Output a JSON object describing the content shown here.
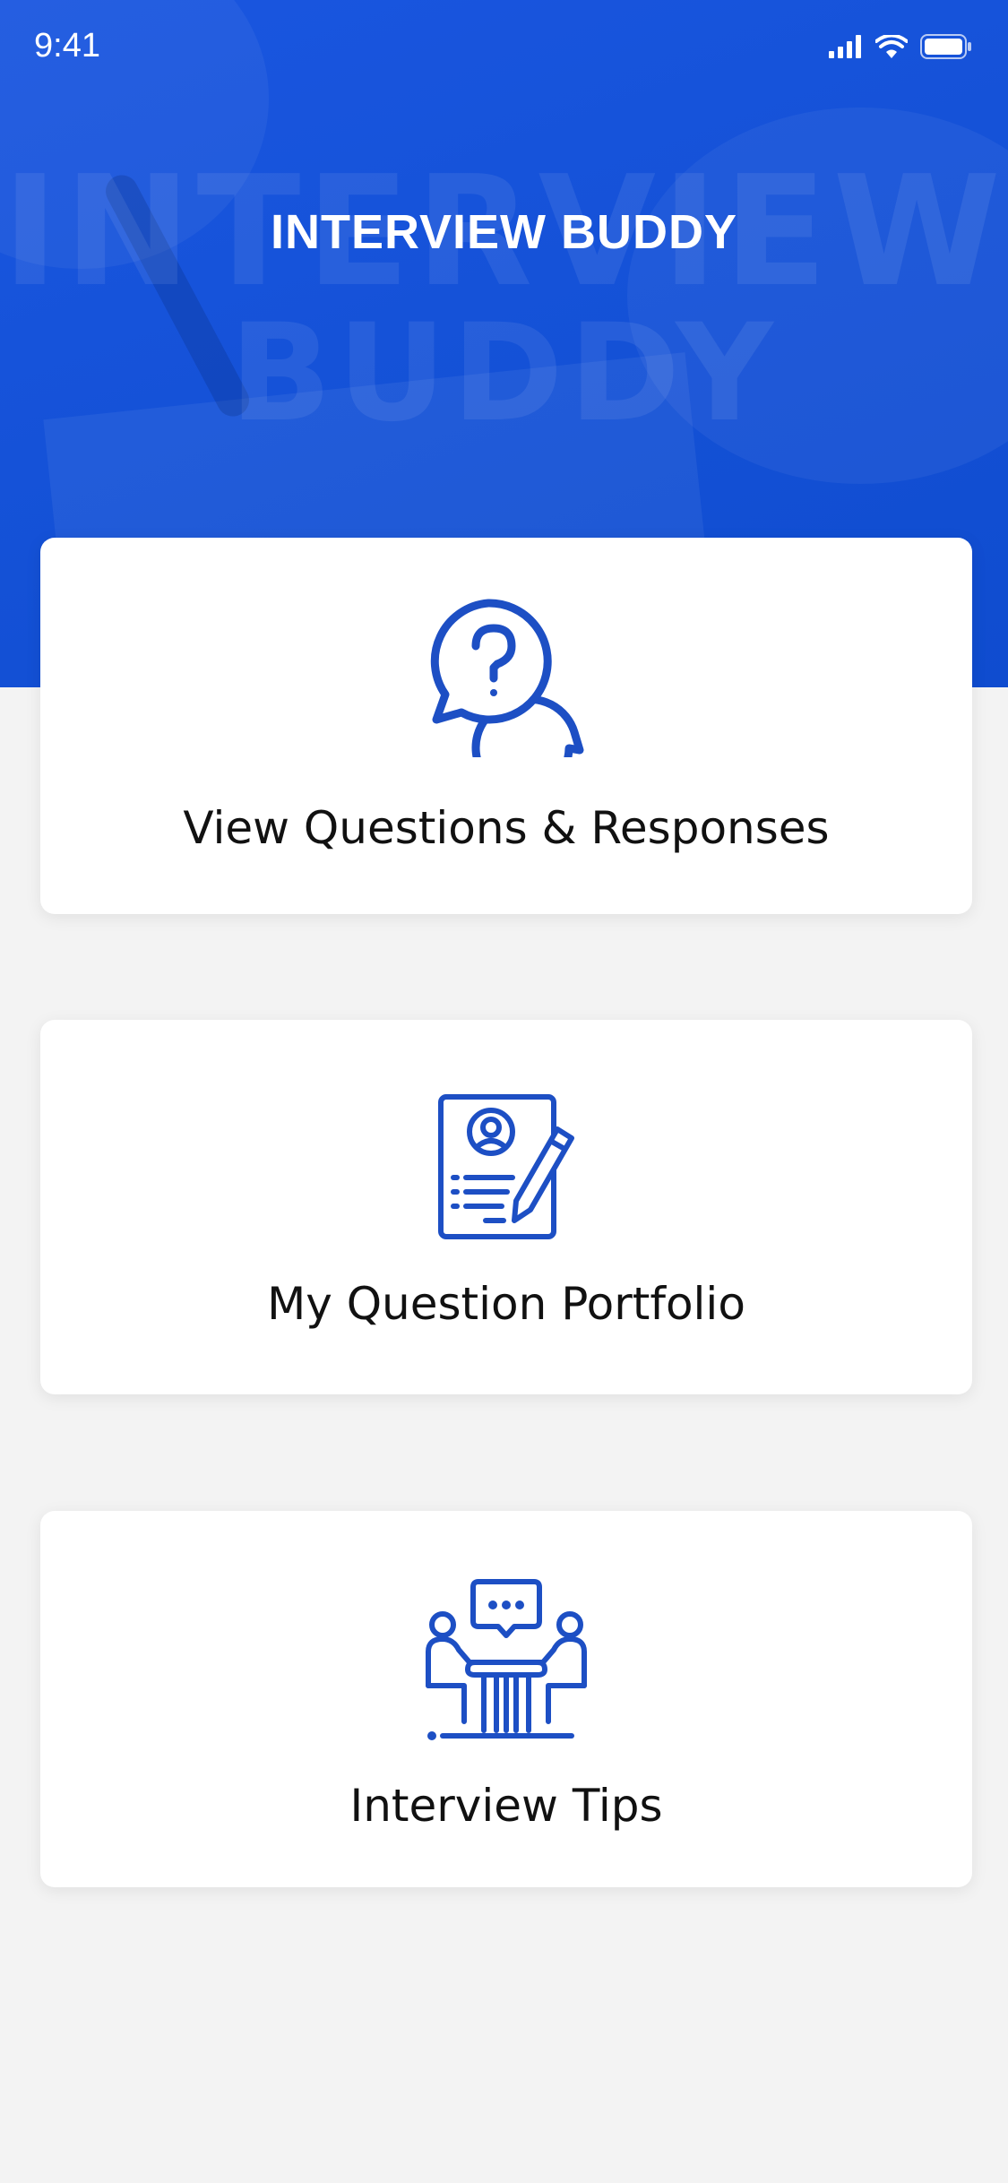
{
  "status_bar": {
    "time": "9:41",
    "icons": [
      "signal-icon",
      "wifi-icon",
      "battery-icon"
    ]
  },
  "header": {
    "title": "INTERVIEW BUDDY",
    "watermark_line1": "INTERVIEW",
    "watermark_line2": "BUDDY"
  },
  "menu": {
    "items": [
      {
        "label": "View Questions & Responses",
        "icon": "question-chat-icon"
      },
      {
        "label": "My Question Portfolio",
        "icon": "portfolio-document-icon"
      },
      {
        "label": "Interview Tips",
        "icon": "interview-meeting-icon"
      }
    ]
  },
  "colors": {
    "brand_blue": "#1a56e0",
    "icon_blue": "#1d4fc4",
    "background": "#f3f3f3",
    "card": "#ffffff"
  }
}
